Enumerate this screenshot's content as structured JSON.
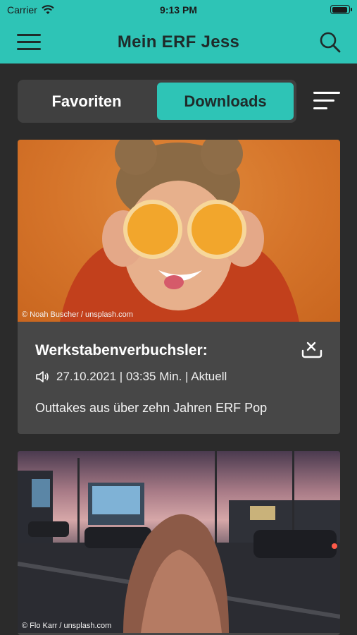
{
  "status_bar": {
    "carrier": "Carrier",
    "time": "9:13 PM"
  },
  "header": {
    "title": "Mein ERF Jess",
    "menu_icon": "hamburger-menu-icon",
    "search_icon": "search-icon"
  },
  "tabs": {
    "favorites": "Favoriten",
    "downloads": "Downloads",
    "active": "Downloads"
  },
  "sort_icon": "sort-lines-icon",
  "cards": [
    {
      "image_credit": "© Noah Buscher / unsplash.com",
      "title": "Werkstabenverbuchsler:",
      "meta": "27.10.2021 | 03:35 Min. | Aktuell",
      "description": "Outtakes aus über zehn Jahren ERF Pop",
      "audio_icon": "speaker-icon",
      "action_icon": "remove-download-icon"
    },
    {
      "image_credit": "© Flo Karr / unsplash.com"
    }
  ],
  "colors": {
    "accent": "#2ec4b6",
    "background": "#2b2b2b",
    "card": "#474747"
  }
}
